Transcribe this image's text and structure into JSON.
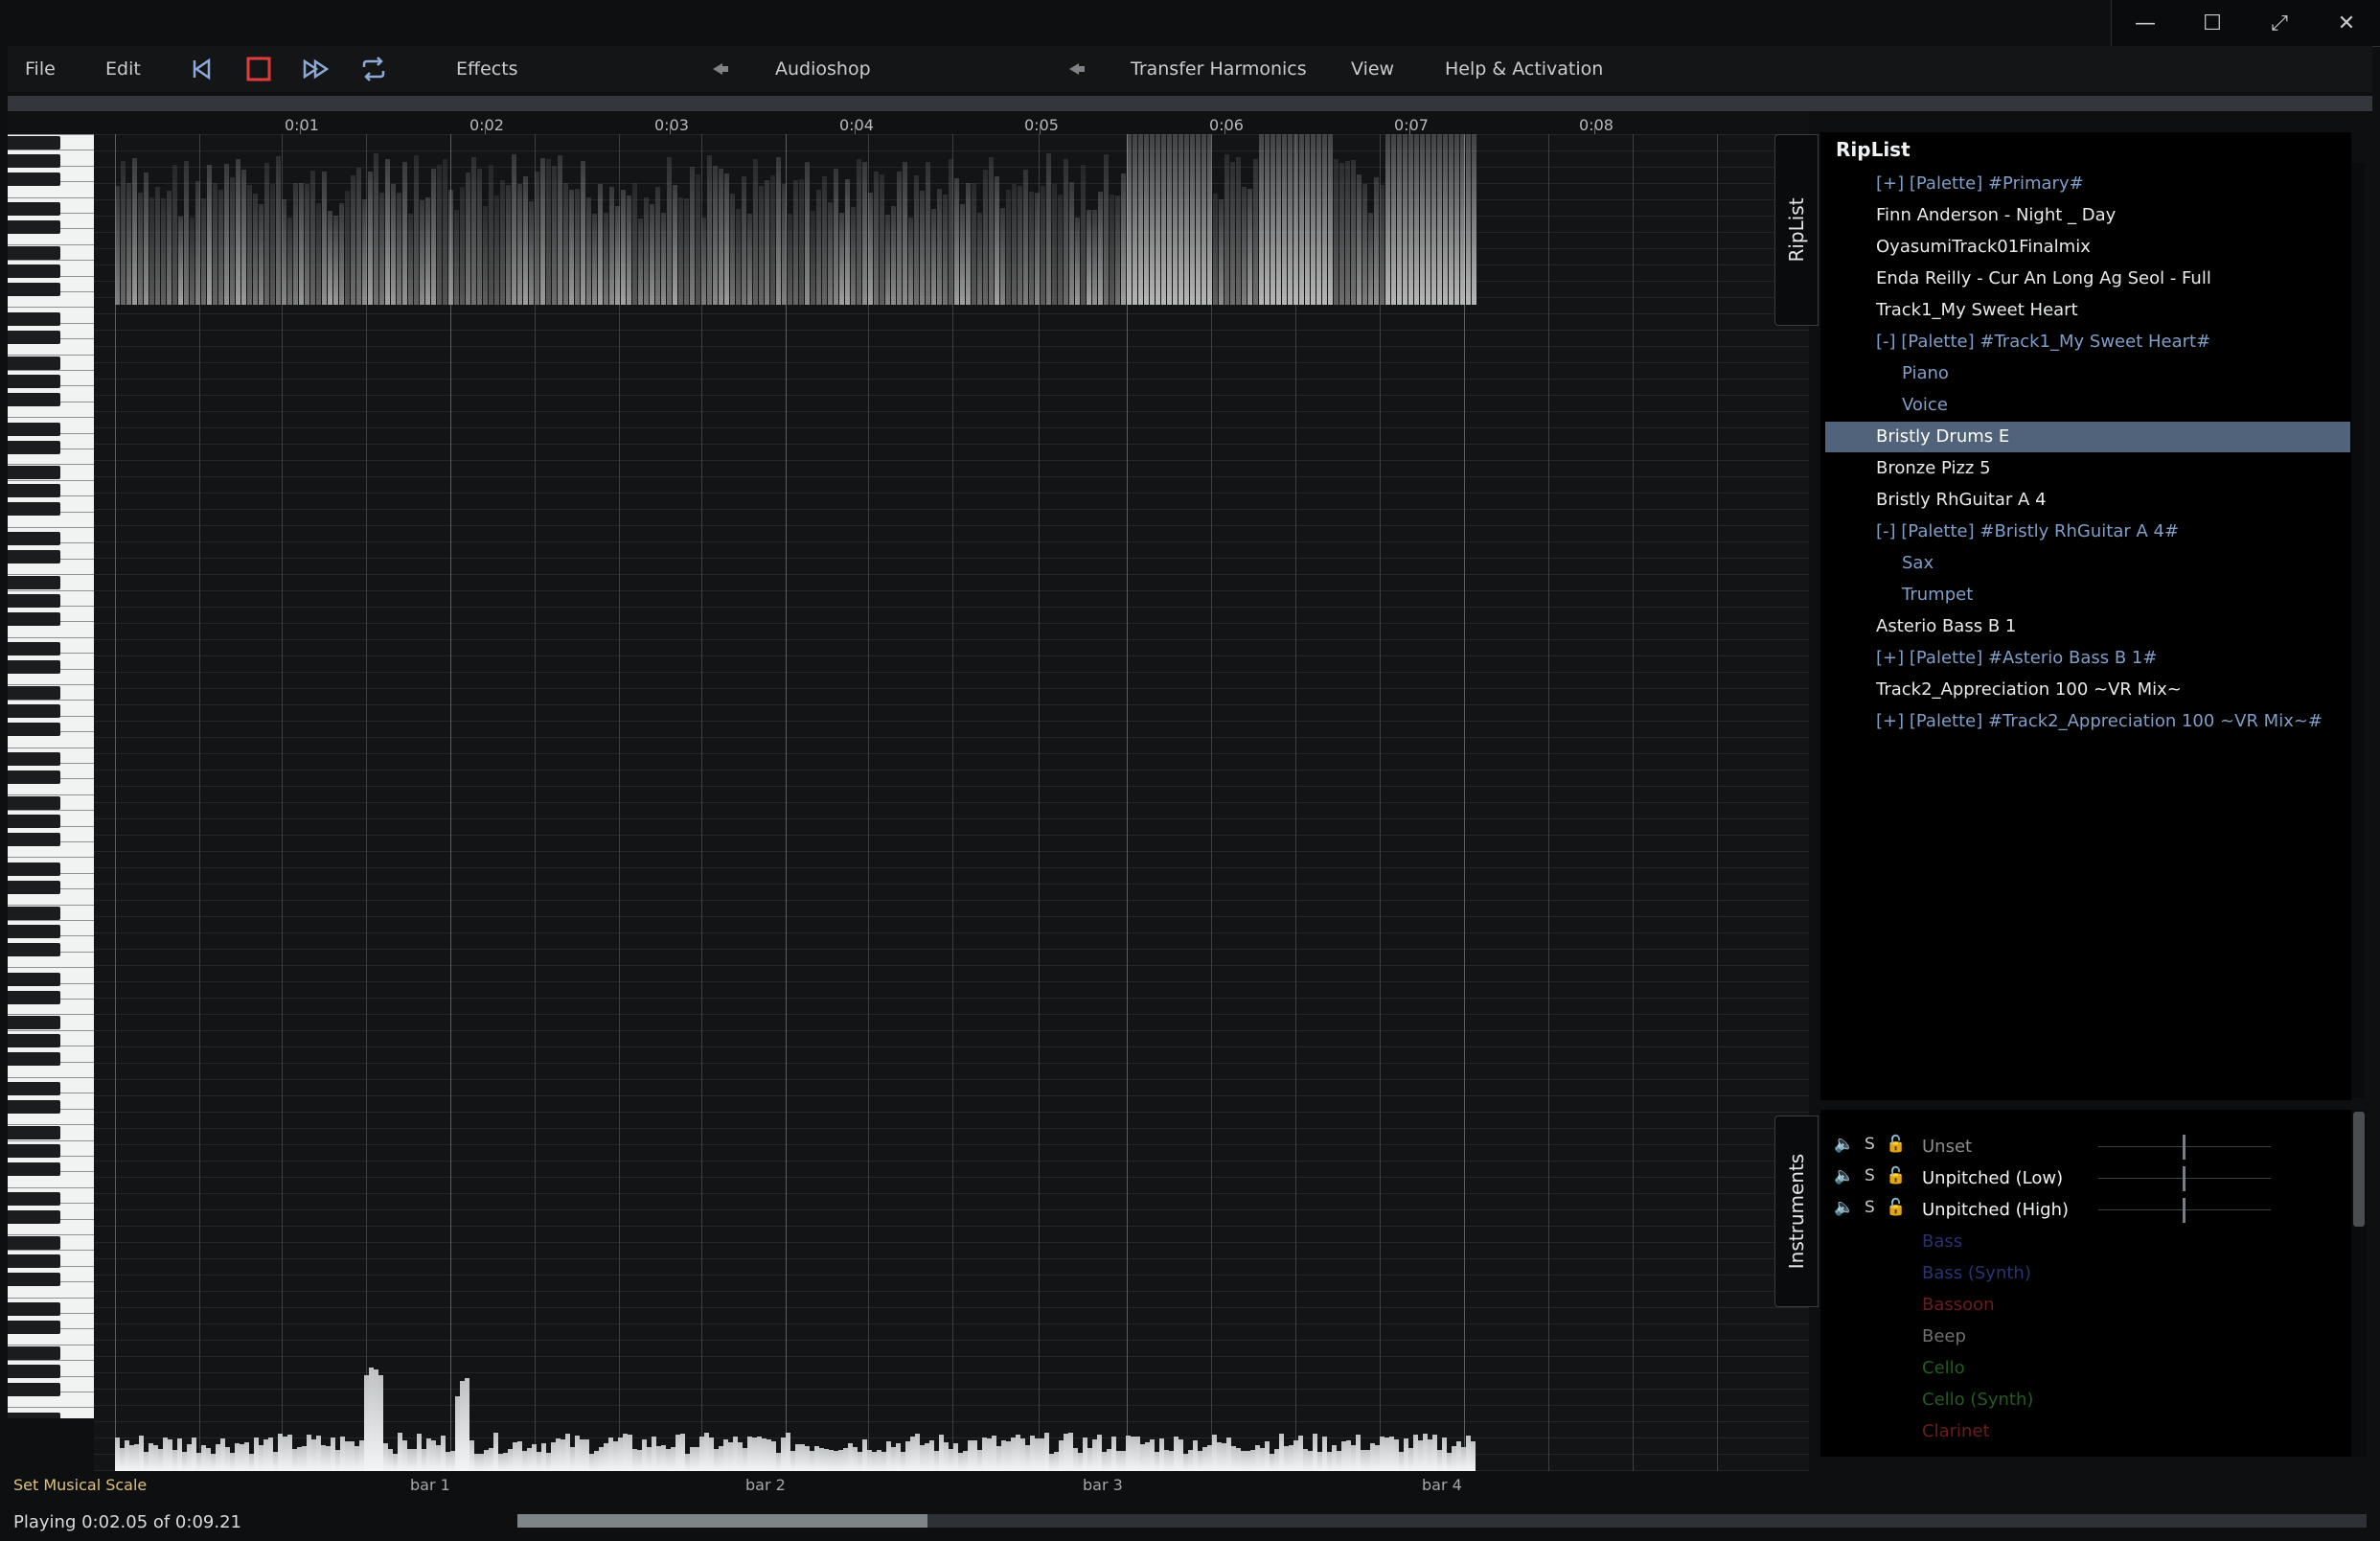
{
  "window": {
    "controls": [
      {
        "name": "minimize-icon",
        "glyph": "—"
      },
      {
        "name": "maximize-icon",
        "glyph": "☐"
      },
      {
        "name": "fullscreen-icon",
        "glyph": "⤢"
      },
      {
        "name": "close-icon",
        "glyph": "✕"
      }
    ]
  },
  "menu": {
    "file": "File",
    "edit": "Edit",
    "effects": "Effects",
    "audioshop": "Audioshop",
    "transfer_harmonics": "Transfer Harmonics",
    "view": "View",
    "help": "Help & Activation"
  },
  "transport": {
    "icons": [
      "skip-to-start-icon",
      "stop-icon",
      "fast-forward-icon",
      "loop-icon"
    ],
    "stop_color": "#e03b3b"
  },
  "timeline": {
    "ticks": [
      "0:01",
      "0:02",
      "0:03",
      "0:04",
      "0:05",
      "0:06",
      "0:07",
      "0:08"
    ],
    "bars": [
      "bar 1",
      "bar 2",
      "bar 3",
      "bar 4"
    ]
  },
  "set_scale": "Set Musical Scale",
  "tabs": {
    "riplist": "RipList",
    "instruments": "Instruments"
  },
  "riplist": {
    "title": "RipList",
    "items": [
      {
        "label": "[+] [Palette] #Primary#",
        "kind": "palette",
        "indent": 1
      },
      {
        "label": "Finn Anderson - Night _ Day",
        "kind": "song",
        "indent": 1
      },
      {
        "label": "OyasumiTrack01Finalmix",
        "kind": "song",
        "indent": 1
      },
      {
        "label": "Enda Reilly - Cur An Long Ag Seol - Full",
        "kind": "song",
        "indent": 1
      },
      {
        "label": "Track1_My Sweet Heart",
        "kind": "song",
        "indent": 1
      },
      {
        "label": "[-] [Palette] #Track1_My Sweet Heart#",
        "kind": "palette",
        "indent": 1
      },
      {
        "label": "Piano",
        "kind": "sub",
        "indent": 2
      },
      {
        "label": "Voice",
        "kind": "sub",
        "indent": 2
      },
      {
        "label": "Bristly Drums E",
        "kind": "song",
        "indent": 1,
        "selected": true
      },
      {
        "label": "Bronze Pizz 5",
        "kind": "song",
        "indent": 1
      },
      {
        "label": "Bristly RhGuitar A 4",
        "kind": "song",
        "indent": 1
      },
      {
        "label": "[-] [Palette] #Bristly RhGuitar A 4#",
        "kind": "palette",
        "indent": 1
      },
      {
        "label": "Sax",
        "kind": "sub",
        "indent": 2
      },
      {
        "label": "Trumpet",
        "kind": "sub",
        "indent": 2
      },
      {
        "label": "Asterio Bass B 1",
        "kind": "song",
        "indent": 1
      },
      {
        "label": "[+] [Palette] #Asterio Bass B 1#",
        "kind": "palette",
        "indent": 1
      },
      {
        "label": "Track2_Appreciation 100 ~VR Mix~",
        "kind": "song",
        "indent": 1
      },
      {
        "label": "[+] [Palette] #Track2_Appreciation 100 ~VR Mix~#",
        "kind": "palette",
        "indent": 1
      }
    ]
  },
  "instruments": {
    "solo_label": "S",
    "rows": [
      {
        "name": "Unset",
        "color": "#8a8c8e",
        "controls": true
      },
      {
        "name": "Unpitched (Low)",
        "color": "#f2f4f6",
        "controls": true
      },
      {
        "name": "Unpitched (High)",
        "color": "#f2f4f6",
        "controls": true
      },
      {
        "name": "Bass",
        "color": "#2b2f6e",
        "controls": false
      },
      {
        "name": "Bass (Synth)",
        "color": "#2a3470",
        "controls": false
      },
      {
        "name": "Bassoon",
        "color": "#6a1c1c",
        "controls": false
      },
      {
        "name": "Beep",
        "color": "#6d6f71",
        "controls": false
      },
      {
        "name": "Cello",
        "color": "#1e5e1e",
        "controls": false
      },
      {
        "name": "Cello (Synth)",
        "color": "#245a24",
        "controls": false
      },
      {
        "name": "Clarinet",
        "color": "#6a1c1c",
        "controls": false
      }
    ]
  },
  "status": {
    "text": "Playing 0:02.05 of 0:09.21",
    "progress": 0.222
  }
}
